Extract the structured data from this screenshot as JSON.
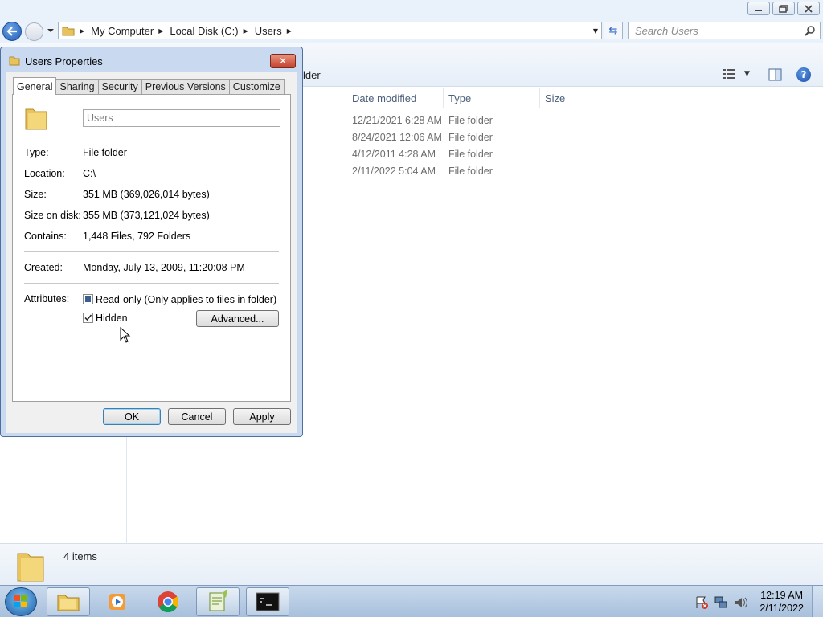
{
  "window": {
    "address": [
      "My Computer",
      "Local Disk (C:)",
      "Users"
    ],
    "search_placeholder": "Search Users",
    "toolbar_partial": "lder",
    "columns": [
      "Date modified",
      "Type",
      "Size"
    ],
    "rows": [
      {
        "date": "12/21/2021 6:28 AM",
        "type": "File folder"
      },
      {
        "date": "8/24/2021 12:06 AM",
        "type": "File folder"
      },
      {
        "date": "4/12/2011 4:28 AM",
        "type": "File folder"
      },
      {
        "date": "2/11/2022 5:04 AM",
        "type": "File folder"
      }
    ],
    "status": "4 items"
  },
  "dialog": {
    "title": "Users Properties",
    "tabs": [
      "General",
      "Sharing",
      "Security",
      "Previous Versions",
      "Customize"
    ],
    "active_tab": "General",
    "folder_name": "Users",
    "labels": {
      "type": "Type:",
      "location": "Location:",
      "size": "Size:",
      "size_on_disk": "Size on disk:",
      "contains": "Contains:",
      "created": "Created:",
      "attributes": "Attributes:"
    },
    "values": {
      "type": "File folder",
      "location": "C:\\",
      "size": "351 MB (369,026,014 bytes)",
      "size_on_disk": "355 MB (373,121,024 bytes)",
      "contains": "1,448 Files, 792 Folders",
      "created": "Monday, July 13, 2009, 11:20:08 PM"
    },
    "readonly_label": "Read-only (Only applies to files in folder)",
    "readonly_state": "indeterminate",
    "hidden_label": "Hidden",
    "hidden_checked": true,
    "advanced_button": "Advanced...",
    "ok_button": "OK",
    "cancel_button": "Cancel",
    "apply_button": "Apply"
  },
  "taskbar": {
    "items": [
      "start-button",
      "windows-explorer",
      "media-player",
      "google-chrome",
      "notepad-plus-plus",
      "command-prompt"
    ],
    "time": "12:19 AM",
    "date": "2/11/2022"
  }
}
